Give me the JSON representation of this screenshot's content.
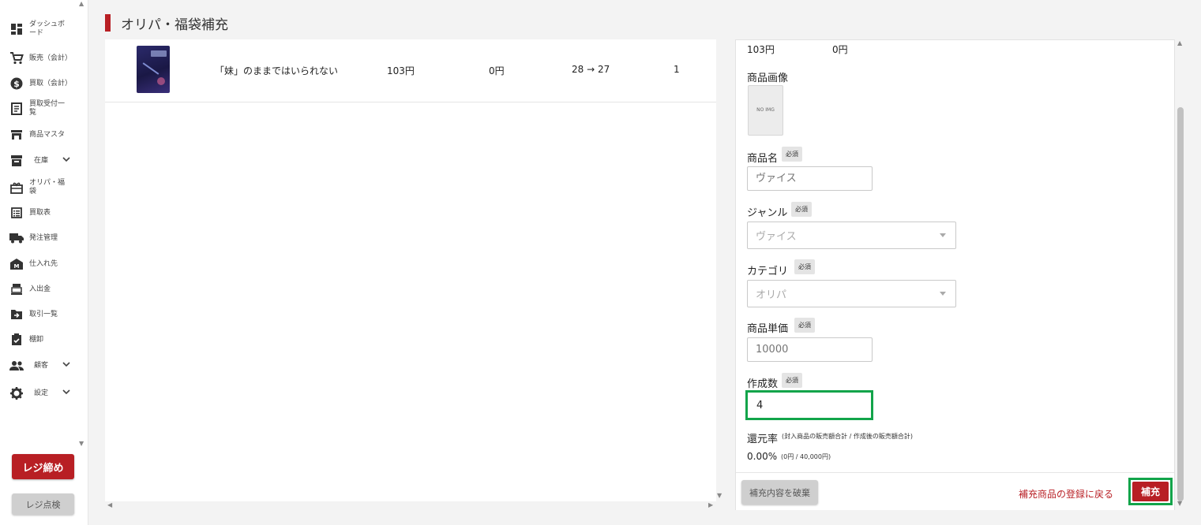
{
  "sidebar": {
    "items": [
      {
        "label": "ダッシュボード",
        "icon": "dashboard-icon"
      },
      {
        "label": "販売（会計）",
        "icon": "cart-icon"
      },
      {
        "label": "買取（会計）",
        "icon": "dollar-icon"
      },
      {
        "label": "買取受付一覧",
        "icon": "receipt-icon"
      },
      {
        "label": "商品マスタ",
        "icon": "store-icon"
      },
      {
        "label": "在庫",
        "icon": "archive-icon"
      },
      {
        "label": "オリパ・福袋",
        "icon": "gift-icon"
      },
      {
        "label": "買取表",
        "icon": "list-icon"
      },
      {
        "label": "発注管理",
        "icon": "truck-icon"
      },
      {
        "label": "仕入れ先",
        "icon": "warehouse-icon"
      },
      {
        "label": "入出金",
        "icon": "register-icon"
      },
      {
        "label": "取引一覧",
        "icon": "folder-arrow-icon"
      },
      {
        "label": "棚卸",
        "icon": "checklist-icon"
      },
      {
        "label": "顧客",
        "icon": "people-icon"
      },
      {
        "label": "設定",
        "icon": "gear-icon"
      }
    ],
    "close_register_label": "レジ締め",
    "check_register_label": "レジ点検"
  },
  "header": {
    "title": "オリパ・福袋補充"
  },
  "table": {
    "rows": [
      {
        "name": "「妹」のままではいられない",
        "price": "103円",
        "value2": "0円",
        "stock": "28 → 27",
        "qty": "1"
      }
    ]
  },
  "form": {
    "summary_price": "103円",
    "summary_value2": "0円",
    "image_label": "商品画像",
    "no_image_text": "NO IMG",
    "required_badge": "必須",
    "name_label": "商品名",
    "name_placeholder": "ヴァイス",
    "genre_label": "ジャンル",
    "genre_value": "ヴァイス",
    "category_label": "カテゴリ",
    "category_value": "オリパ",
    "unit_price_label": "商品単価",
    "unit_price_placeholder": "10000",
    "quantity_label": "作成数",
    "quantity_value": "4",
    "return_rate_label": "還元率",
    "return_rate_note": "(封入商品の販売額合計 / 作成後の販売額合計)",
    "return_rate_value": "0.00%",
    "return_rate_detail": "(0円 / 40,000円)",
    "discard_label": "補充内容を破棄",
    "back_label": "補充商品の登録に戻る",
    "submit_label": "補充"
  },
  "colors": {
    "accent": "#b81f24",
    "highlight": "#12a44a"
  }
}
